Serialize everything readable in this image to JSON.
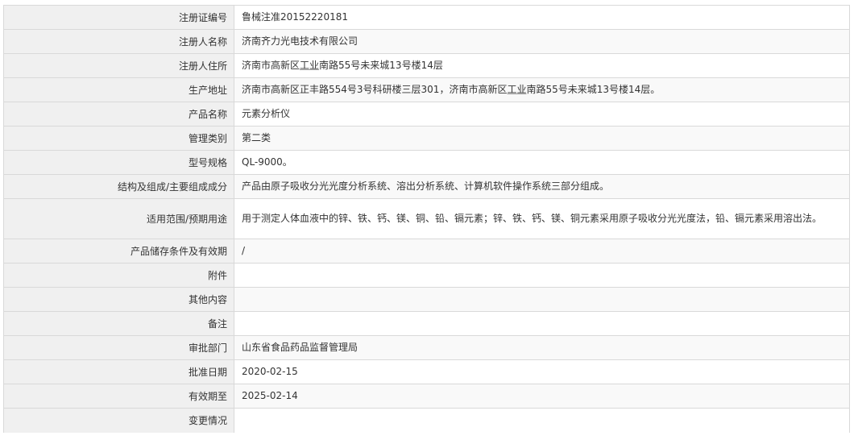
{
  "rows": [
    {
      "label": "注册证编号",
      "value": "鲁械注准20152220181"
    },
    {
      "label": "注册人名称",
      "value": "济南齐力光电技术有限公司"
    },
    {
      "label": "注册人住所",
      "value_pre": "济南市高新区",
      "value_link": "工业",
      "value_post": "南路55号未来城13号楼14层"
    },
    {
      "label": "生产地址",
      "value_pre": "济南市高新区正丰路554号3号科研楼三层301，济南市高新区",
      "value_link": "工业",
      "value_post": "南路55号未来城13号楼14层。"
    },
    {
      "label": "产品名称",
      "value": "元素分析仪"
    },
    {
      "label": "管理类别",
      "value": "第二类"
    },
    {
      "label": "型号规格",
      "value": "QL-9000。"
    },
    {
      "label": "结构及组成/主要组成成分",
      "value": "产品由原子吸收分光光度分析系统、溶出分析系统、计算机软件操作系统三部分组成。"
    },
    {
      "label": "适用范围/预期用途",
      "value": "用于测定人体血液中的锌、铁、钙、镁、铜、铅、镉元素；锌、铁、钙、镁、铜元素采用原子吸收分光光度法，铅、镉元素采用溶出法。"
    },
    {
      "label": "产品储存条件及有效期",
      "value": "/"
    },
    {
      "label": "附件",
      "value": ""
    },
    {
      "label": "其他内容",
      "value": ""
    },
    {
      "label": "备注",
      "value": ""
    },
    {
      "label": "审批部门",
      "value": "山东省食品药品监督管理局"
    },
    {
      "label": "批准日期",
      "value": "2020-02-15"
    },
    {
      "label": "有效期至",
      "value": "2025-02-14"
    },
    {
      "label": "变更情况",
      "value": ""
    }
  ]
}
